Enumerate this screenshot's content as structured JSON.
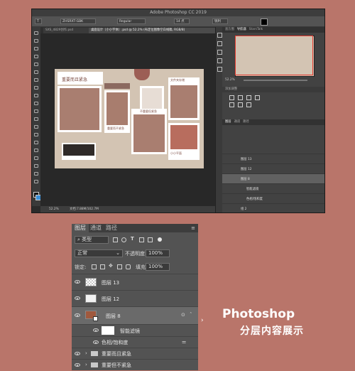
{
  "window": {
    "title": "Adobe Photoshop CC 2019"
  },
  "options": {
    "font": "ZHSRXT-GBK",
    "style": "Regular",
    "size": "14 点",
    "aa": "锐利"
  },
  "doc_tabs": [
    "SXS_4829创作.psd",
    "桌面设计（小小字体）.psd @ 52.2% (布定位图像空白线稿, RGB/8)"
  ],
  "status": {
    "zoom": "52.2%",
    "doc": "文档:7.88M/102.7M"
  },
  "canvas_text": {
    "headline": "重要而且紧急",
    "side": "文件夹存储",
    "label1": "重要而不紧急",
    "label2": "不重要但紧急",
    "label3": "小小平面"
  },
  "right_panel": {
    "nav_tabs": [
      "直方图",
      "导航器",
      "StarsTalk"
    ],
    "nav_zoom": "52.2%",
    "adj_title": "添加调整",
    "layers_tabs": [
      "图层",
      "通道",
      "路径"
    ],
    "mini_layers": [
      "图层 13",
      "图层 12",
      "图层 8",
      "智能滤镜",
      "色相/饱和度",
      "组 2"
    ]
  },
  "layers_panel": {
    "tabs": [
      "图层",
      "通道",
      "路径"
    ],
    "filter_label": "类型",
    "blend_mode": "正常",
    "opacity_label": "不透明度:",
    "opacity_value": "100%",
    "lock_label": "锁定:",
    "fill_label": "填充:",
    "fill_value": "100%",
    "layers": [
      {
        "name": "图层 13"
      },
      {
        "name": "图层 12"
      },
      {
        "name": "图层 8"
      },
      {
        "name": "智能滤镜"
      },
      {
        "name": "色相/饱和度"
      },
      {
        "name": "重要而且紧急"
      },
      {
        "name": "重要但不紧急"
      }
    ]
  },
  "caption": {
    "line1": "Photoshop",
    "line2": "分层内容展示"
  },
  "colors": {
    "background": "#b9756a",
    "accent_red": "#e23b30",
    "selected_row": "#6a6a6a"
  }
}
